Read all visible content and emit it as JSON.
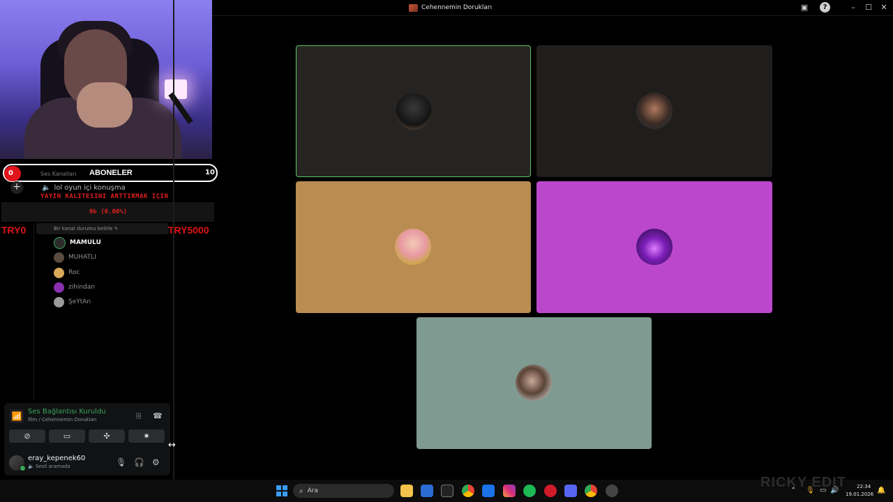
{
  "window": {
    "title": "Cehennemin Dorukları"
  },
  "overlay": {
    "sub_count_left": "0",
    "sub_title": "ABONELER",
    "sub_target": "10",
    "channels_hint": "Ses Kanalları",
    "red_notice": "YAYIN KALITESINI ARTTIRMAK IÇIN",
    "progress": "0₺ (0.00%)",
    "try_left": "TRY0",
    "try_right": "TRY5000"
  },
  "sidebar": {
    "voice_channel": "lol oyun içi konuşma",
    "channel_status_placeholder": "Bir kanal durumu belirle",
    "members": [
      {
        "name": "MAMULU",
        "color": "#2b2b2b"
      },
      {
        "name": "MUHATLI",
        "color": "#5a4a40"
      },
      {
        "name": "Roc",
        "color": "#d9a85a"
      },
      {
        "name": "zihindan",
        "color": "#8a2fb0"
      },
      {
        "name": "ŞeYtAn",
        "color": "#9a9a9a"
      }
    ]
  },
  "voice_panel": {
    "title": "Ses Bağlantısı Kuruldu",
    "subtitle": "film / Cehennemin Dorukları"
  },
  "user": {
    "name": "eray_kepenek60",
    "status": "Sesli aramada"
  },
  "tiles": [
    {
      "name": "tile-1",
      "color": "#262422",
      "active": true
    },
    {
      "name": "tile-2",
      "color": "#1f1e1d",
      "active": false
    },
    {
      "name": "tile-3",
      "color": "#b98c52",
      "active": false
    },
    {
      "name": "tile-4",
      "color": "#bb48cc",
      "active": false
    },
    {
      "name": "tile-5",
      "color": "#7f9a90",
      "active": false
    }
  ],
  "taskbar": {
    "search_label": "Ara",
    "time": "22:34",
    "date": "19.01.2026"
  },
  "watermark": "RICKY EDIT"
}
